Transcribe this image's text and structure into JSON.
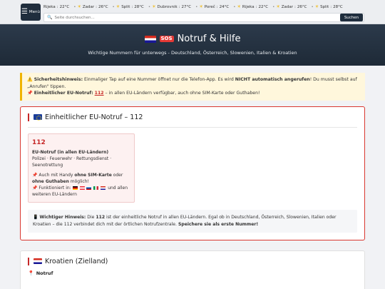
{
  "topbar": {
    "menu_label": "Menü",
    "ticker": [
      {
        "city": "Rijeka",
        "temp": "22°C"
      },
      {
        "city": "Zadar",
        "temp": "26°C"
      },
      {
        "city": "Split",
        "temp": "28°C"
      },
      {
        "city": "Dubrovnik",
        "temp": "27°C"
      },
      {
        "city": "Poreč",
        "temp": "24°C"
      },
      {
        "city": "Rijeka",
        "temp": "22°C"
      },
      {
        "city": "Zadar",
        "temp": "26°C"
      },
      {
        "city": "Split",
        "temp": "28°C"
      }
    ],
    "search_placeholder": "Seite durchsuchen...",
    "search_button": "Suchen"
  },
  "hero": {
    "sos": "SOS",
    "title": "Notruf & Hilfe",
    "subtitle": "Wichtige Nummern für unterwegs - Deutschland, Österreich, Slowenien, Italien & Kroatien"
  },
  "notice": {
    "line1_label": "Sicherheitshinweis:",
    "line1_text_a": " Einmaliger Tap auf eine Nummer öffnet nur die Telefon-App. Es wird ",
    "line1_bold": "NICHT automatisch angerufen",
    "line1_text_b": "! Du musst selbst auf „Anrufen\" tippen.",
    "line2_label": "Einheitlicher EU-Notruf:",
    "line2_number": "112",
    "line2_text": " – in allen EU-Ländern verfügbar, auch ohne SIM-Karte oder Guthaben!"
  },
  "eu_card": {
    "title": "Einheitlicher EU-Notruf – 112",
    "number": "112",
    "name": "EU-Notruf (in allen EU-Ländern)",
    "services": "Polizei · Feuerwehr · Rettungsdienst · Seenotrettung",
    "note_a": "Auch mit Handy ",
    "note_b1": "ohne SIM-Karte",
    "note_c": " oder ",
    "note_b2": "ohne Guthaben",
    "note_d": " möglich!",
    "works_label": "Funktioniert in: ",
    "works_text": " und allen weiteren EU-Ländern",
    "hint_label": "Wichtiger Hinweis:",
    "hint_a": " Die ",
    "hint_num": "112",
    "hint_b": " ist der einheitliche Notruf in allen EU-Ländern. Egal ob in Deutschland, Österreich, Slowenien, Italien oder Kroatien – die 112 verbindet dich mit der örtlichen Notrufzentrale. ",
    "hint_bold": "Speichere sie als erste Nummer!"
  },
  "hr_card": {
    "title": "Kroatien (Zielland)",
    "sub": "Notruf"
  },
  "colors": {
    "accent_red": "#c62828",
    "dark_nav": "#1f2d3d",
    "notice_bg": "#fff7dc"
  }
}
